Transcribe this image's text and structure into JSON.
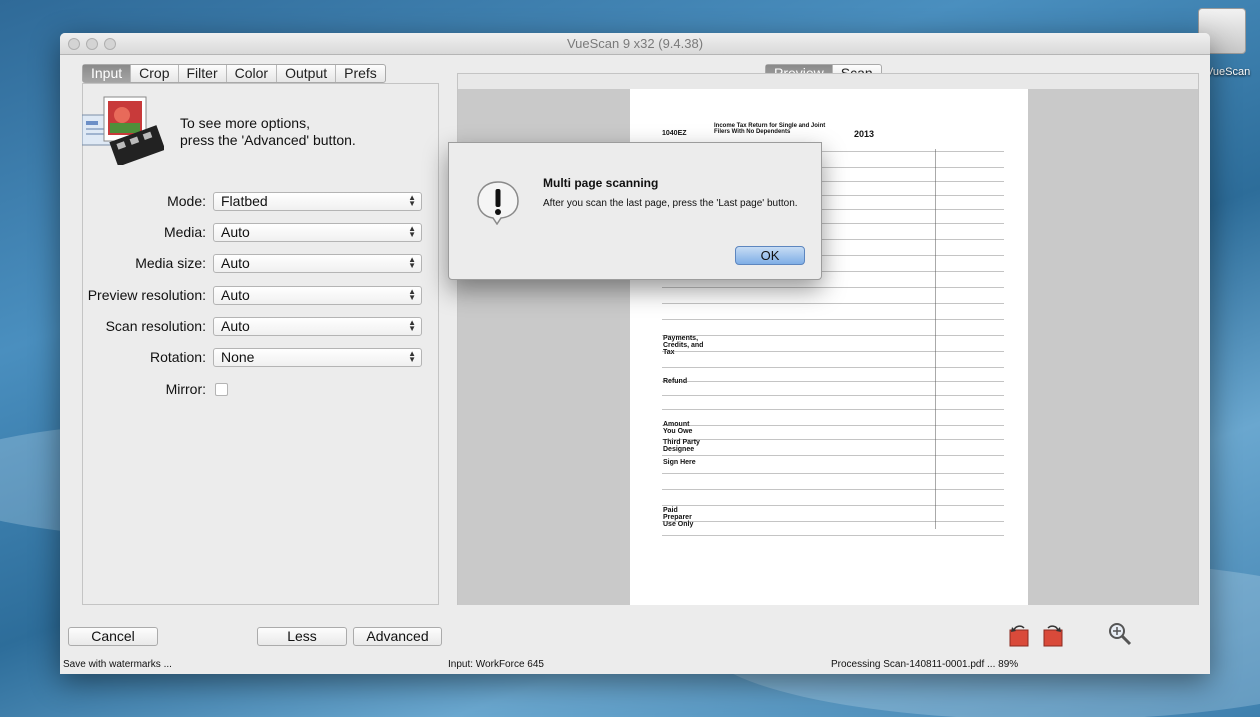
{
  "desktop": {
    "icon_label": "VueScan"
  },
  "window": {
    "title": "VueScan 9 x32 (9.4.38)"
  },
  "left_tabs": [
    "Input",
    "Crop",
    "Filter",
    "Color",
    "Output",
    "Prefs"
  ],
  "right_tabs": [
    "Preview",
    "Scan"
  ],
  "hint": {
    "text": "To see more options,\npress the 'Advanced' button."
  },
  "options": [
    {
      "label": "Mode:",
      "value": "Flatbed"
    },
    {
      "label": "Media:",
      "value": "Auto"
    },
    {
      "label": "Media size:",
      "value": "Auto"
    },
    {
      "label": "Preview resolution:",
      "value": "Auto"
    },
    {
      "label": "Scan resolution:",
      "value": "Auto"
    },
    {
      "label": "Rotation:",
      "value": "None"
    }
  ],
  "mirror": {
    "label": "Mirror:",
    "checked": false
  },
  "dialog": {
    "title": "Multi page scanning",
    "message": "After you scan the last page, press the 'Last page' button.",
    "ok_label": "OK"
  },
  "buttons": {
    "cancel": "Cancel",
    "less": "Less",
    "advanced": "Advanced"
  },
  "status": {
    "left": "Save with watermarks ...",
    "middle": "Input: WorkForce 645",
    "right": "Processing Scan-140811-0001.pdf ... 89%"
  },
  "document": {
    "form_number": "1040EZ",
    "year": "2013",
    "heading": "Income Tax Return for Single and Joint Filers With No Dependents",
    "sections": [
      "Payments, Credits, and Tax",
      "Refund",
      "Amount You Owe",
      "Third Party Designee",
      "Sign Here",
      "Paid Preparer Use Only"
    ]
  },
  "colors": {
    "accent": "#7faee6",
    "active_tab": "#8a8a8a"
  },
  "icons": [
    "scanner-photo-icon",
    "alert-icon",
    "rotate-left-icon",
    "rotate-right-icon",
    "zoom-icon"
  ]
}
